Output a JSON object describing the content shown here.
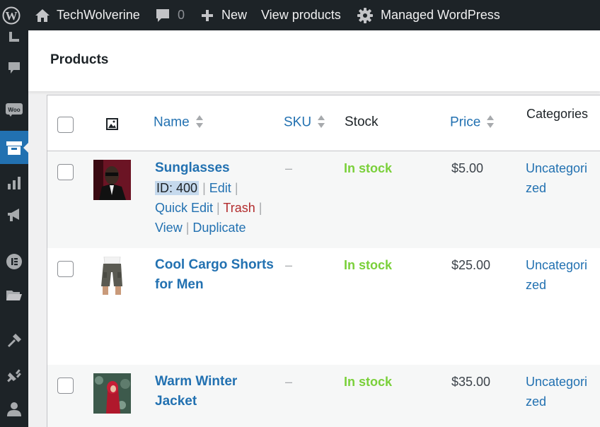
{
  "admin_bar": {
    "site_name": "TechWolverine",
    "comments_count": "0",
    "new_label": "New",
    "view_products_label": "View products",
    "managed_label": "Managed WordPress"
  },
  "page": {
    "title": "Products"
  },
  "table": {
    "columns": {
      "name": "Name",
      "sku": "SKU",
      "stock": "Stock",
      "price": "Price",
      "categories": "Categories"
    },
    "rows": [
      {
        "name": "Sunglasses",
        "sku": "–",
        "stock": "In stock",
        "price": "$5.00",
        "category": "Uncategorized",
        "actions": {
          "id": "ID: 400",
          "edit": "Edit",
          "quick_edit": "Quick Edit",
          "trash": "Trash",
          "view": "View",
          "duplicate": "Duplicate"
        }
      },
      {
        "name": "Cool Cargo Shorts for Men",
        "sku": "–",
        "stock": "In stock",
        "price": "$25.00",
        "category": "Uncategorized"
      },
      {
        "name": "Warm Winter Jacket",
        "sku": "–",
        "stock": "In stock",
        "price": "$35.00",
        "category": "Uncategorized"
      }
    ]
  },
  "colors": {
    "admin_bar_bg": "#1d2327",
    "link": "#2271b1",
    "in_stock": "#7ad03a",
    "trash": "#b32d2e",
    "active_menu": "#2271b1"
  },
  "icons": [
    "wordpress-icon",
    "home-icon",
    "comment-icon",
    "plus-icon",
    "gear-icon",
    "image-icon",
    "sort-icon"
  ]
}
